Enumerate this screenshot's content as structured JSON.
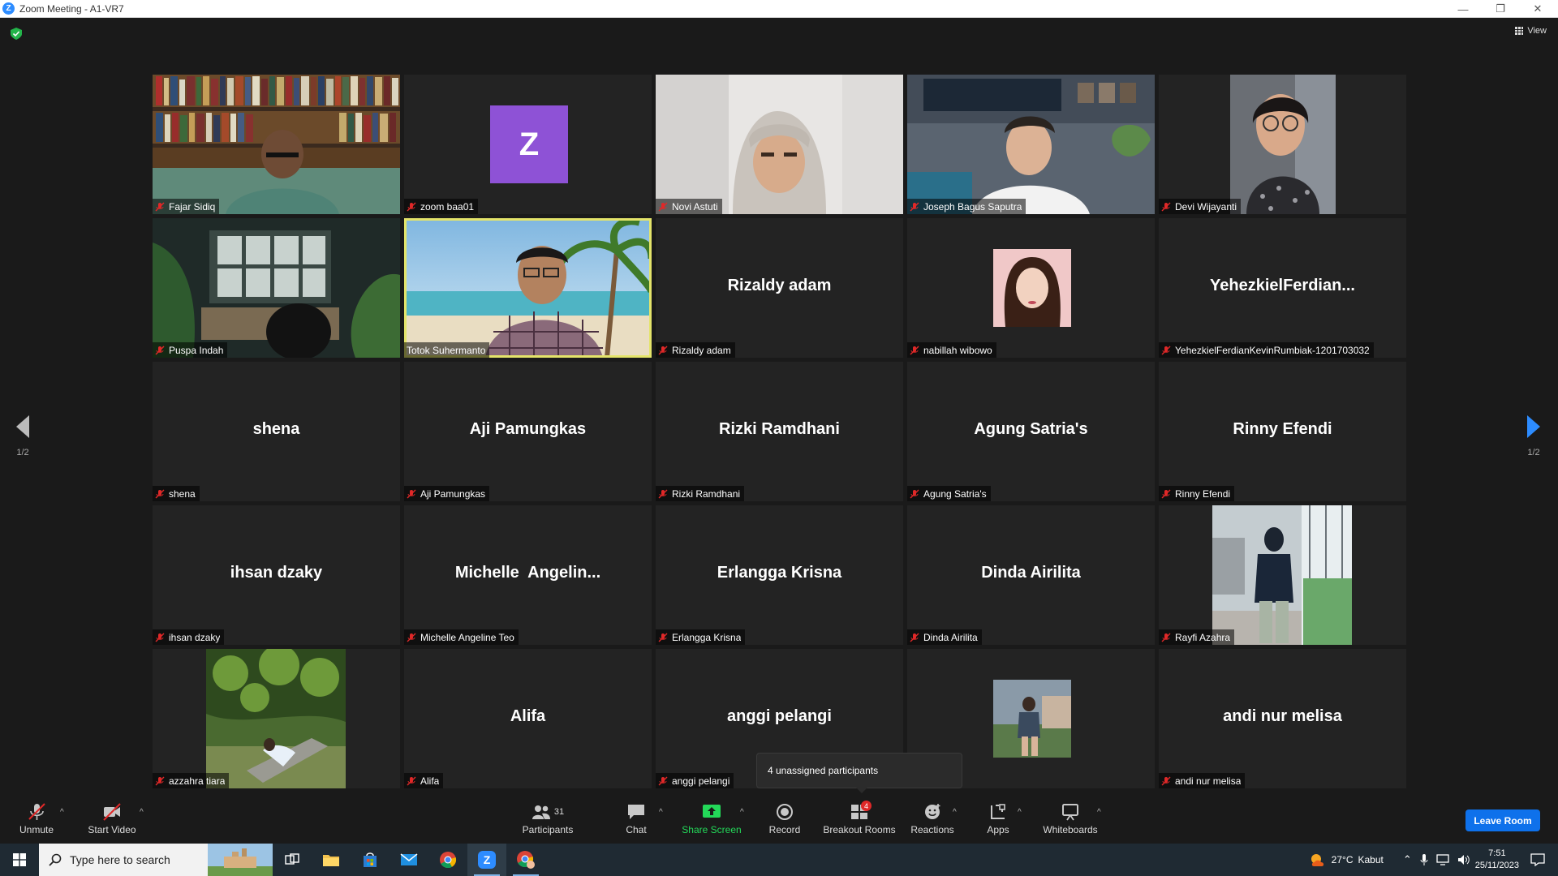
{
  "window": {
    "title": "Zoom Meeting - A1-VR7",
    "minimize": "—",
    "restore": "❐",
    "close": "✕"
  },
  "view_label": "View",
  "page_indicator": {
    "left": "1/2",
    "right": "1/2"
  },
  "tiles": [
    {
      "label": "Fajar Sidiq",
      "big": ""
    },
    {
      "label": "zoom baa01",
      "big": "",
      "avatar_letter": "Z"
    },
    {
      "label": "Novi Astuti",
      "big": ""
    },
    {
      "label": "Joseph Bagus Saputra",
      "big": ""
    },
    {
      "label": "Devi Wijayanti",
      "big": ""
    },
    {
      "label": "Puspa Indah",
      "big": ""
    },
    {
      "label": "Totok Suhermanto",
      "big": ""
    },
    {
      "label": "Rizaldy adam",
      "big": "Rizaldy adam"
    },
    {
      "label": "nabillah wibowo",
      "big": ""
    },
    {
      "label": "YehezkielFerdianKevinRumbiak-1201703032",
      "big": "YehezkielFerdian..."
    },
    {
      "label": "shena",
      "big": "shena"
    },
    {
      "label": "Aji Pamungkas",
      "big": "Aji Pamungkas"
    },
    {
      "label": "Rizki Ramdhani",
      "big": "Rizki Ramdhani"
    },
    {
      "label": "Agung Satria's",
      "big": "Agung Satria's"
    },
    {
      "label": "Rinny Efendi",
      "big": "Rinny Efendi"
    },
    {
      "label": "ihsan dzaky",
      "big": "ihsan dzaky"
    },
    {
      "label": "Michelle Angeline Teo",
      "big": "Michelle  Angelin..."
    },
    {
      "label": "Erlangga Krisna",
      "big": "Erlangga Krisna"
    },
    {
      "label": "Dinda Airilita",
      "big": "Dinda Airilita"
    },
    {
      "label": "Rayfi Azahra",
      "big": ""
    },
    {
      "label": "azzahra tiara",
      "big": ""
    },
    {
      "label": "Alifa",
      "big": "Alifa"
    },
    {
      "label": "anggi pelangi",
      "big": "anggi pelangi"
    },
    {
      "label": "",
      "big": ""
    },
    {
      "label": "andi nur melisa",
      "big": "andi nur melisa"
    }
  ],
  "tooltip": "4 unassigned participants",
  "toolbar": {
    "unmute": "Unmute",
    "start_video": "Start Video",
    "participants": "Participants",
    "participants_count": "31",
    "chat": "Chat",
    "share_screen": "Share Screen",
    "record": "Record",
    "breakout_rooms": "Breakout Rooms",
    "breakout_badge": "4",
    "reactions": "Reactions",
    "apps": "Apps",
    "whiteboards": "Whiteboards",
    "leave": "Leave Room",
    "caret": "^"
  },
  "taskbar": {
    "search_placeholder": "Type here to search",
    "weather_temp": "27°C",
    "weather_desc": "Kabut",
    "time": "7:51",
    "date": "25/11/2023"
  },
  "colors": {
    "accent": "#2d8cff",
    "mute_red": "#e02828",
    "share_green": "#23d959",
    "active_speaker": "#e4e46a",
    "avatar_purple": "#8e52d6"
  }
}
